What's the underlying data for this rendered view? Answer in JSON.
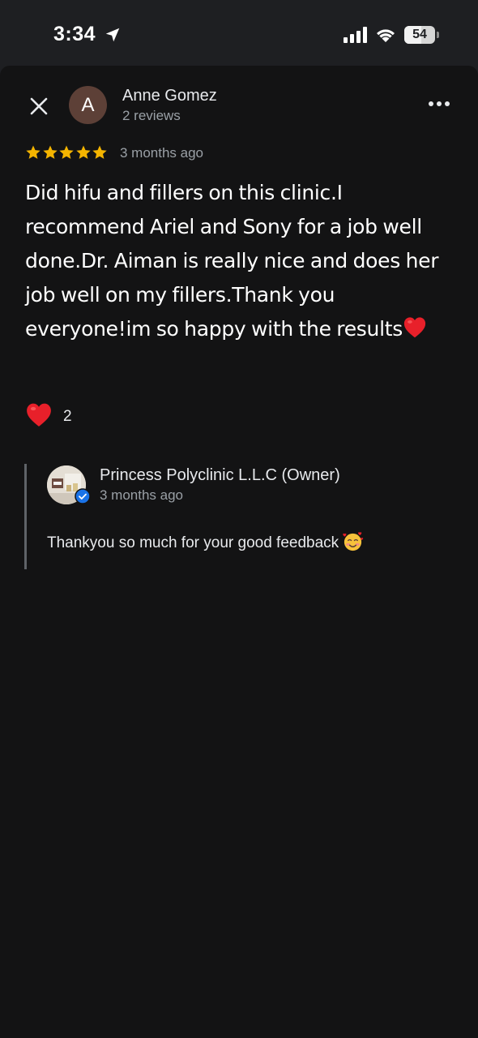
{
  "status_bar": {
    "time": "3:34",
    "battery_level": "54",
    "battery_percent": 54,
    "icons": [
      "location-arrow-icon",
      "cellular-signal-icon",
      "wifi-icon",
      "battery-icon"
    ]
  },
  "review": {
    "reviewer": {
      "initial": "A",
      "name": "Anne Gomez",
      "reviews_count": "2 reviews",
      "avatar_color": "#5d4037"
    },
    "rating": 5,
    "time": "3 months ago",
    "text": "Did hifu and fillers on this clinic.I recommend Ariel  and  Sony for a job well done.Dr. Aiman is really nice and does her job well on my fillers.Thank you everyone!im so happy with the results",
    "text_emoji": "heart-emoji",
    "reaction": {
      "icon": "heart-emoji-icon",
      "count": "2"
    }
  },
  "owner_reply": {
    "name": "Princess Polyclinic L.L.C (Owner)",
    "time": "3 months ago",
    "text": "Thankyou so much for your good feedback",
    "emoji": "smiling-face-with-hearts-emoji"
  },
  "colors": {
    "background": "#131314",
    "status_bar": "#1e1f22",
    "star": "#f4b400",
    "heart": "#e8202a",
    "verified": "#1a73e8",
    "secondary_text": "#9aa0a6"
  }
}
